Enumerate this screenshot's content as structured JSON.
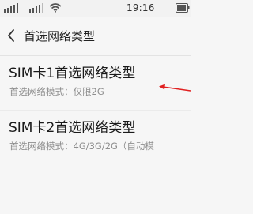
{
  "status_bar": {
    "time": "19:16",
    "icons": [
      "signal-icon",
      "signal-icon",
      "wifi-icon",
      "battery-icon"
    ]
  },
  "header": {
    "back_icon": "chevron-left-icon",
    "title": "首选网络类型"
  },
  "list": {
    "items": [
      {
        "title": "SIM卡1首选网络类型",
        "subtitle": "首选网络模式：仅限2G"
      },
      {
        "title": "SIM卡2首选网络类型",
        "subtitle": "首选网络模式：4G/3G/2G（自动模"
      }
    ]
  },
  "annotation": {
    "arrow_color": "#e02020"
  }
}
